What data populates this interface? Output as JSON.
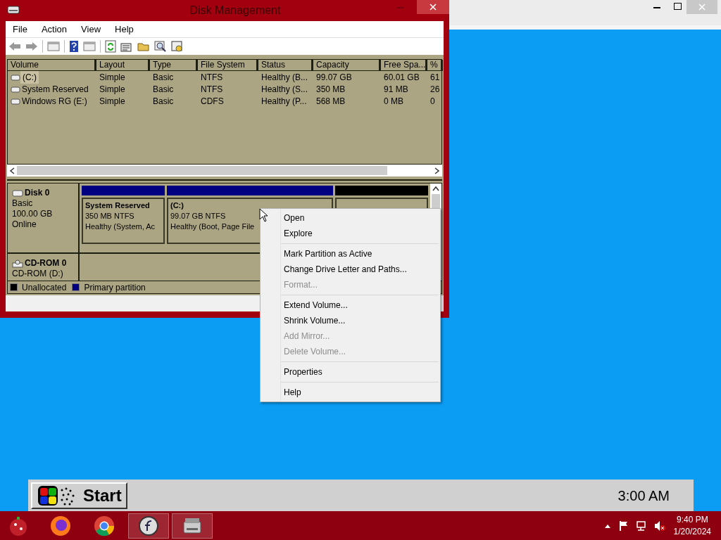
{
  "window": {
    "title": "Disk Management"
  },
  "menu_bar": [
    "File",
    "Action",
    "View",
    "Help"
  ],
  "volume_list": {
    "columns": [
      "Volume",
      "Layout",
      "Type",
      "File System",
      "Status",
      "Capacity",
      "Free Spa...",
      "%"
    ],
    "rows": [
      {
        "cells": [
          "(C:)",
          "Simple",
          "Basic",
          "NTFS",
          "Healthy (B...",
          "99.07 GB",
          "60.01 GB",
          "61"
        ],
        "selected": true
      },
      {
        "cells": [
          "System Reserved",
          "Simple",
          "Basic",
          "NTFS",
          "Healthy (S...",
          "350 MB",
          "91 MB",
          "26"
        ],
        "selected": false
      },
      {
        "cells": [
          "Windows RG (E:)",
          "Simple",
          "Basic",
          "CDFS",
          "Healthy (P...",
          "568 MB",
          "0 MB",
          "0"
        ],
        "selected": false
      }
    ]
  },
  "disks": [
    {
      "name": "Disk 0",
      "kind": "disk",
      "lines": [
        "Basic",
        "100.00 GB",
        "Online"
      ],
      "partitions": [
        {
          "title": "System Reserved",
          "lines": [
            "350 MB NTFS",
            "Healthy (System, Ac"
          ],
          "color": "#000080"
        },
        {
          "title": "(C:)",
          "lines": [
            "99.07 GB NTFS",
            "Healthy (Boot, Page File"
          ],
          "color": "#000080"
        },
        {
          "color": "#000000"
        }
      ]
    },
    {
      "name": "CD-ROM 0",
      "kind": "cdrom",
      "lines": [
        "CD-ROM (D:)"
      ]
    }
  ],
  "legend": [
    {
      "label": "Unallocated",
      "color": "#000000"
    },
    {
      "label": "Primary partition",
      "color": "#000080"
    }
  ],
  "context_menu": [
    {
      "kind": "item",
      "label": "Open",
      "disabled": false
    },
    {
      "kind": "item",
      "label": "Explore",
      "disabled": false
    },
    {
      "kind": "separator"
    },
    {
      "kind": "item",
      "label": "Mark Partition as Active",
      "disabled": false
    },
    {
      "kind": "item",
      "label": "Change Drive Letter and Paths...",
      "disabled": false
    },
    {
      "kind": "item",
      "label": "Format...",
      "disabled": true
    },
    {
      "kind": "separator"
    },
    {
      "kind": "item",
      "label": "Extend Volume...",
      "disabled": false
    },
    {
      "kind": "item",
      "label": "Shrink Volume...",
      "disabled": false
    },
    {
      "kind": "item",
      "label": "Add Mirror...",
      "disabled": true
    },
    {
      "kind": "item",
      "label": "Delete Volume...",
      "disabled": true
    },
    {
      "kind": "separator"
    },
    {
      "kind": "item",
      "label": "Properties",
      "disabled": false
    },
    {
      "kind": "separator"
    },
    {
      "kind": "item",
      "label": "Help",
      "disabled": false
    }
  ],
  "start_bar": {
    "start": "Start",
    "clock": "3:00 AM"
  },
  "taskbar": {
    "time": "9:40 PM",
    "date": "1/20/2024"
  }
}
